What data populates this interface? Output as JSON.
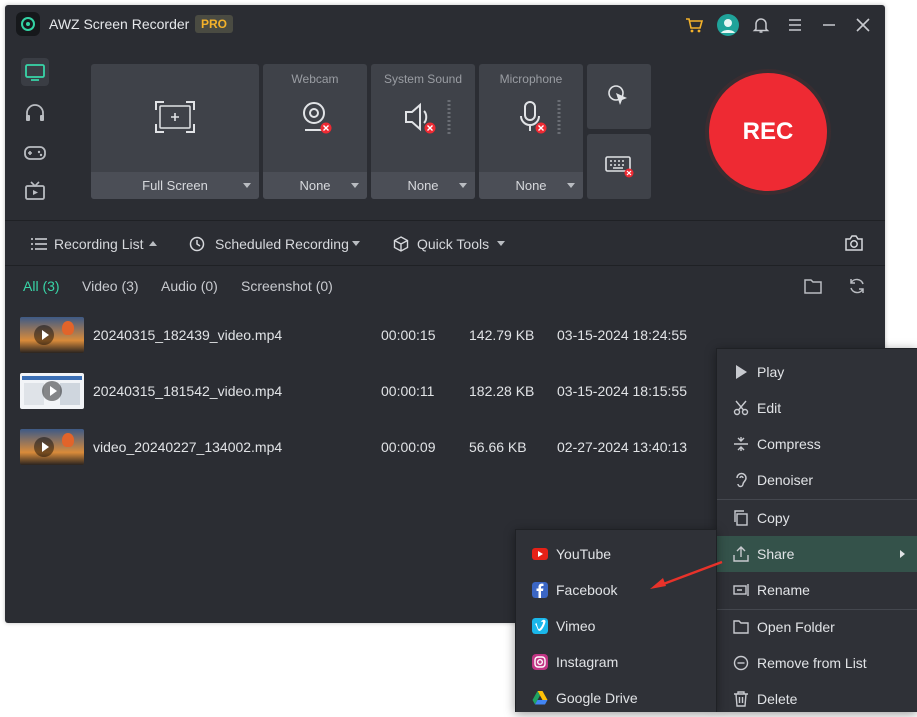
{
  "app": {
    "title": "AWZ Screen Recorder",
    "badge": "PRO"
  },
  "title_icons": [
    "cart-icon",
    "avatar",
    "bell-icon",
    "hamburger-menu-icon",
    "minimize-icon",
    "close-icon"
  ],
  "sources": {
    "screen": {
      "value": "Full Screen"
    },
    "webcam": {
      "label": "Webcam",
      "value": "None"
    },
    "system_sound": {
      "label": "System Sound",
      "value": "None"
    },
    "microphone": {
      "label": "Microphone",
      "value": "None"
    }
  },
  "rec_button": {
    "label": "REC"
  },
  "toolbar": {
    "recording_list": "Recording List",
    "scheduled_recording": "Scheduled Recording",
    "quick_tools": "Quick Tools"
  },
  "tabs": [
    {
      "label": "All (3)",
      "active": true
    },
    {
      "label": "Video (3)"
    },
    {
      "label": "Audio (0)"
    },
    {
      "label": "Screenshot (0)"
    }
  ],
  "recordings": [
    {
      "name": "20240315_182439_video.mp4",
      "duration": "00:00:15",
      "size": "142.79 KB",
      "date": "03-15-2024 18:24:55"
    },
    {
      "name": "20240315_181542_video.mp4",
      "duration": "00:00:11",
      "size": "182.28 KB",
      "date": "03-15-2024 18:15:55"
    },
    {
      "name": "video_20240227_134002.mp4",
      "duration": "00:00:09",
      "size": "56.66 KB",
      "date": "02-27-2024 13:40:13"
    }
  ],
  "context_menu": {
    "items": [
      {
        "label": "Play",
        "icon": "play-icon"
      },
      {
        "label": "Edit",
        "icon": "scissors-icon"
      },
      {
        "label": "Compress",
        "icon": "compress-icon"
      },
      {
        "label": "Denoiser",
        "icon": "ear-icon"
      },
      {
        "label": "Copy",
        "icon": "copy-icon"
      },
      {
        "label": "Share",
        "icon": "share-icon"
      },
      {
        "label": "Rename",
        "icon": "rename-icon"
      },
      {
        "label": "Open Folder",
        "icon": "folder-icon"
      },
      {
        "label": "Remove from List",
        "icon": "remove-icon"
      },
      {
        "label": "Delete",
        "icon": "trash-icon"
      }
    ]
  },
  "share_menu": {
    "items": [
      {
        "label": "YouTube",
        "icon": "youtube-icon",
        "color": "#e62117"
      },
      {
        "label": "Facebook",
        "icon": "facebook-icon",
        "color": "#3b66c4"
      },
      {
        "label": "Vimeo",
        "icon": "vimeo-icon",
        "color": "#1ab7ea"
      },
      {
        "label": "Instagram",
        "icon": "instagram-icon",
        "color": "#c13584"
      },
      {
        "label": "Google Drive",
        "icon": "google-drive-icon",
        "color": "#1fa463"
      }
    ]
  },
  "colors": {
    "accent": "#38d6a8",
    "rec": "#ee2a33",
    "pro": "#f4b22a",
    "annotation_arrow": "#e8322a"
  }
}
